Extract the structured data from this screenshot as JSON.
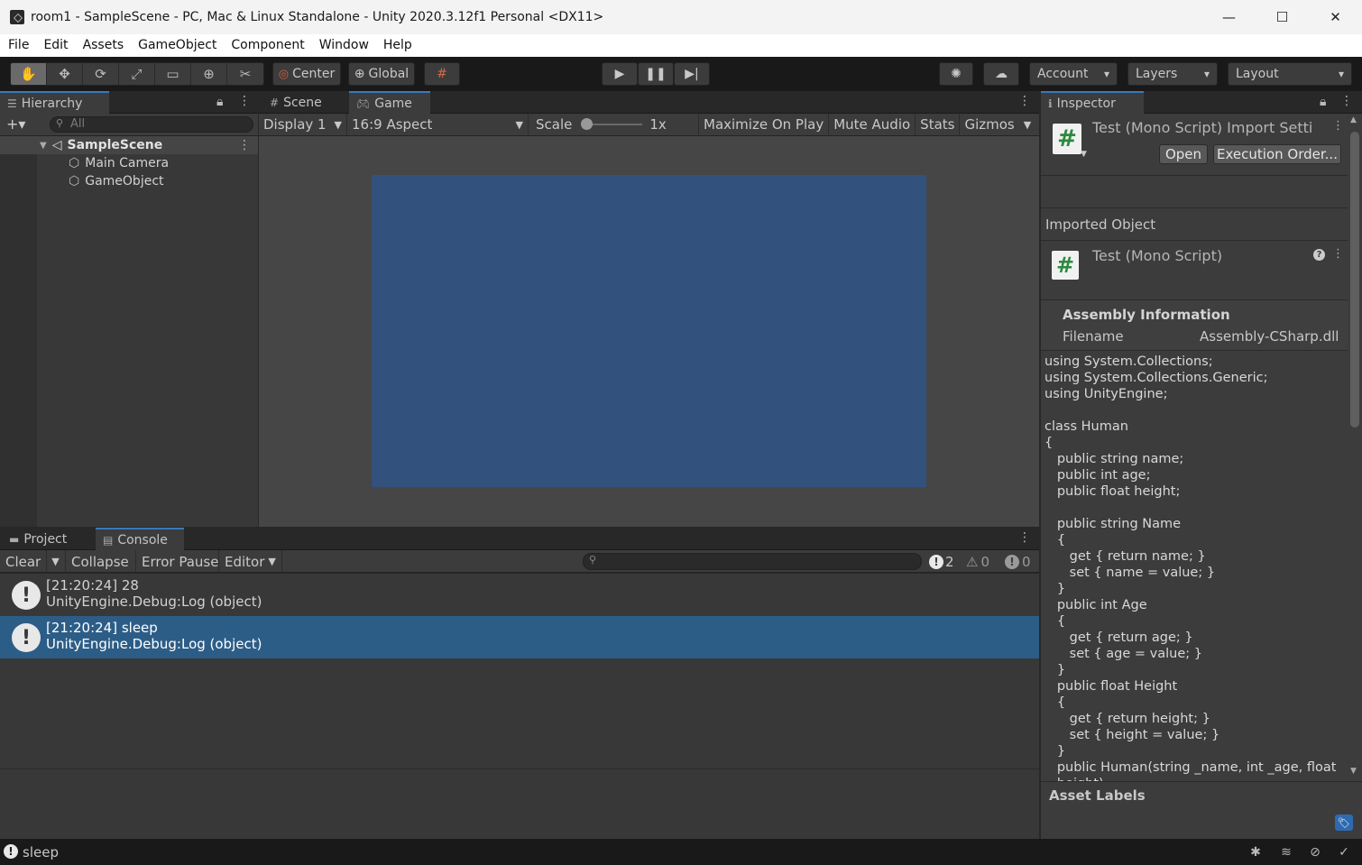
{
  "window": {
    "title": "room1 - SampleScene - PC, Mac & Linux Standalone - Unity 2020.3.12f1 Personal <DX11>"
  },
  "menu": [
    "File",
    "Edit",
    "Assets",
    "GameObject",
    "Component",
    "Window",
    "Help"
  ],
  "toolbar": {
    "pivot_label": "Center",
    "space_label": "Global",
    "account_label": "Account",
    "layers_label": "Layers",
    "layout_label": "Layout"
  },
  "hierarchy": {
    "tab_label": "Hierarchy",
    "search_placeholder": "All",
    "scene_name": "SampleScene",
    "objects": [
      "Main Camera",
      "GameObject"
    ]
  },
  "game_view": {
    "tabs": [
      "Scene",
      "Game"
    ],
    "display": "Display 1",
    "aspect": "16:9 Aspect",
    "scale_label": "Scale",
    "scale_value": "1x",
    "maximize_label": "Maximize On Play",
    "mute_label": "Mute Audio",
    "stats_label": "Stats",
    "gizmos_label": "Gizmos",
    "screen_color": "#32517c"
  },
  "console": {
    "tabs": [
      "Project",
      "Console"
    ],
    "clear_label": "Clear",
    "collapse_label": "Collapse",
    "error_pause_label": "Error Pause",
    "editor_label": "Editor",
    "log_count": "2",
    "warning_count": "0",
    "error_count": "0",
    "entries": [
      {
        "line1": "[21:20:24] 28",
        "line2": "UnityEngine.Debug:Log (object)"
      },
      {
        "line1": "[21:20:24] sleep",
        "line2": "UnityEngine.Debug:Log (object)"
      }
    ]
  },
  "inspector": {
    "tab_label": "Inspector",
    "header_title": "Test (Mono Script) Import Setti",
    "open_label": "Open",
    "execution_order_label": "Execution Order...",
    "imported_object_label": "Imported Object",
    "script_name": "Test (Mono Script)",
    "assembly_info_label": "Assembly Information",
    "filename_label": "Filename",
    "filename_value": "Assembly-CSharp.dll",
    "code": "using System.Collections;\nusing System.Collections.Generic;\nusing UnityEngine;\n\nclass Human\n{\n   public string name;\n   public int age;\n   public float height;\n\n   public string Name\n   {\n      get { return name; }\n      set { name = value; }\n   }\n   public int Age\n   {\n      get { return age; }\n      set { age = value; }\n   }\n   public float Height\n   {\n      get { return height; }\n      set { height = value; }\n   }\n   public Human(string _name, int _age, float\n   height)",
    "asset_labels_label": "Asset Labels"
  },
  "status_bar": {
    "message": "sleep"
  },
  "colors": {
    "accent": "#3a79bb",
    "selection": "#2c5d87",
    "panel": "#383838"
  }
}
